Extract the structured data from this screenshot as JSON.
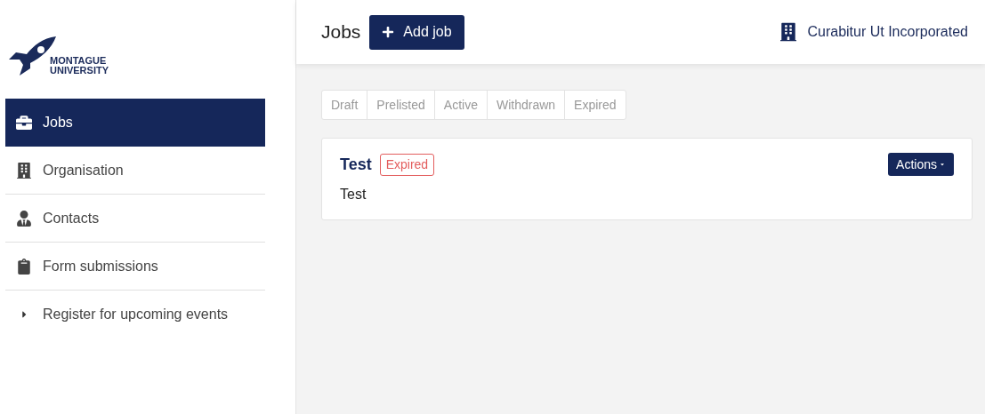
{
  "logo": {
    "lines": [
      "MONTAGUE",
      "UNIVERSITY"
    ]
  },
  "sidebar": {
    "items": [
      {
        "label": "Jobs",
        "kind": "link",
        "selected": true
      },
      {
        "label": "Organisation",
        "kind": "link",
        "selected": false
      },
      {
        "label": "Contacts",
        "kind": "link",
        "selected": false
      },
      {
        "label": "Form submissions",
        "kind": "link",
        "selected": false
      },
      {
        "label": "Register for upcoming events",
        "kind": "group",
        "selected": false
      }
    ]
  },
  "header": {
    "title": "Jobs",
    "add_button": "Add job",
    "organisation": "Curabitur Ut Incorporated"
  },
  "tabs": [
    {
      "label": "Draft",
      "selected": false
    },
    {
      "label": "Prelisted",
      "selected": false
    },
    {
      "label": "Active",
      "selected": false
    },
    {
      "label": "Withdrawn",
      "selected": false
    },
    {
      "label": "Expired",
      "selected": false
    }
  ],
  "jobs": [
    {
      "title": "Test",
      "status": "Expired",
      "color": "#e35d5d",
      "description": "Test",
      "actions": "Actions"
    }
  ]
}
